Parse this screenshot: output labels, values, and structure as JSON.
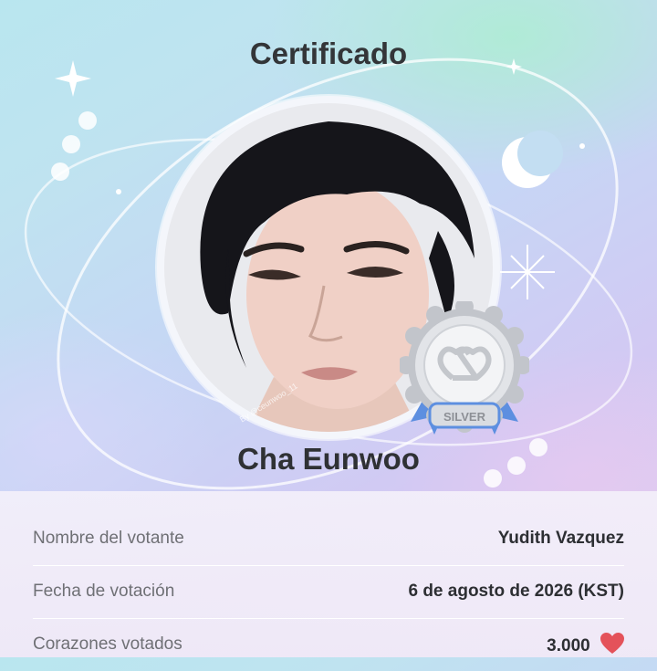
{
  "certificate": {
    "title": "Certificado",
    "recipient_name": "Cha Eunwoo",
    "portrait_watermark": "By @ceunwoo_11"
  },
  "badge": {
    "tier": "SILVER",
    "icon": "double-heart-icon"
  },
  "details": [
    {
      "label": "Nombre del votante",
      "value": "Yudith Vazquez"
    },
    {
      "label": "Fecha de votación",
      "value": "6 de agosto de 2026 (KST)"
    },
    {
      "label": "Corazones votados",
      "value": "3.000",
      "icon": "heart-icon"
    }
  ],
  "colors": {
    "heart": "#e4525a",
    "title_text": "#333538",
    "ribbon": "#5d8fe0",
    "medal_silver": "#c9ccd1"
  }
}
